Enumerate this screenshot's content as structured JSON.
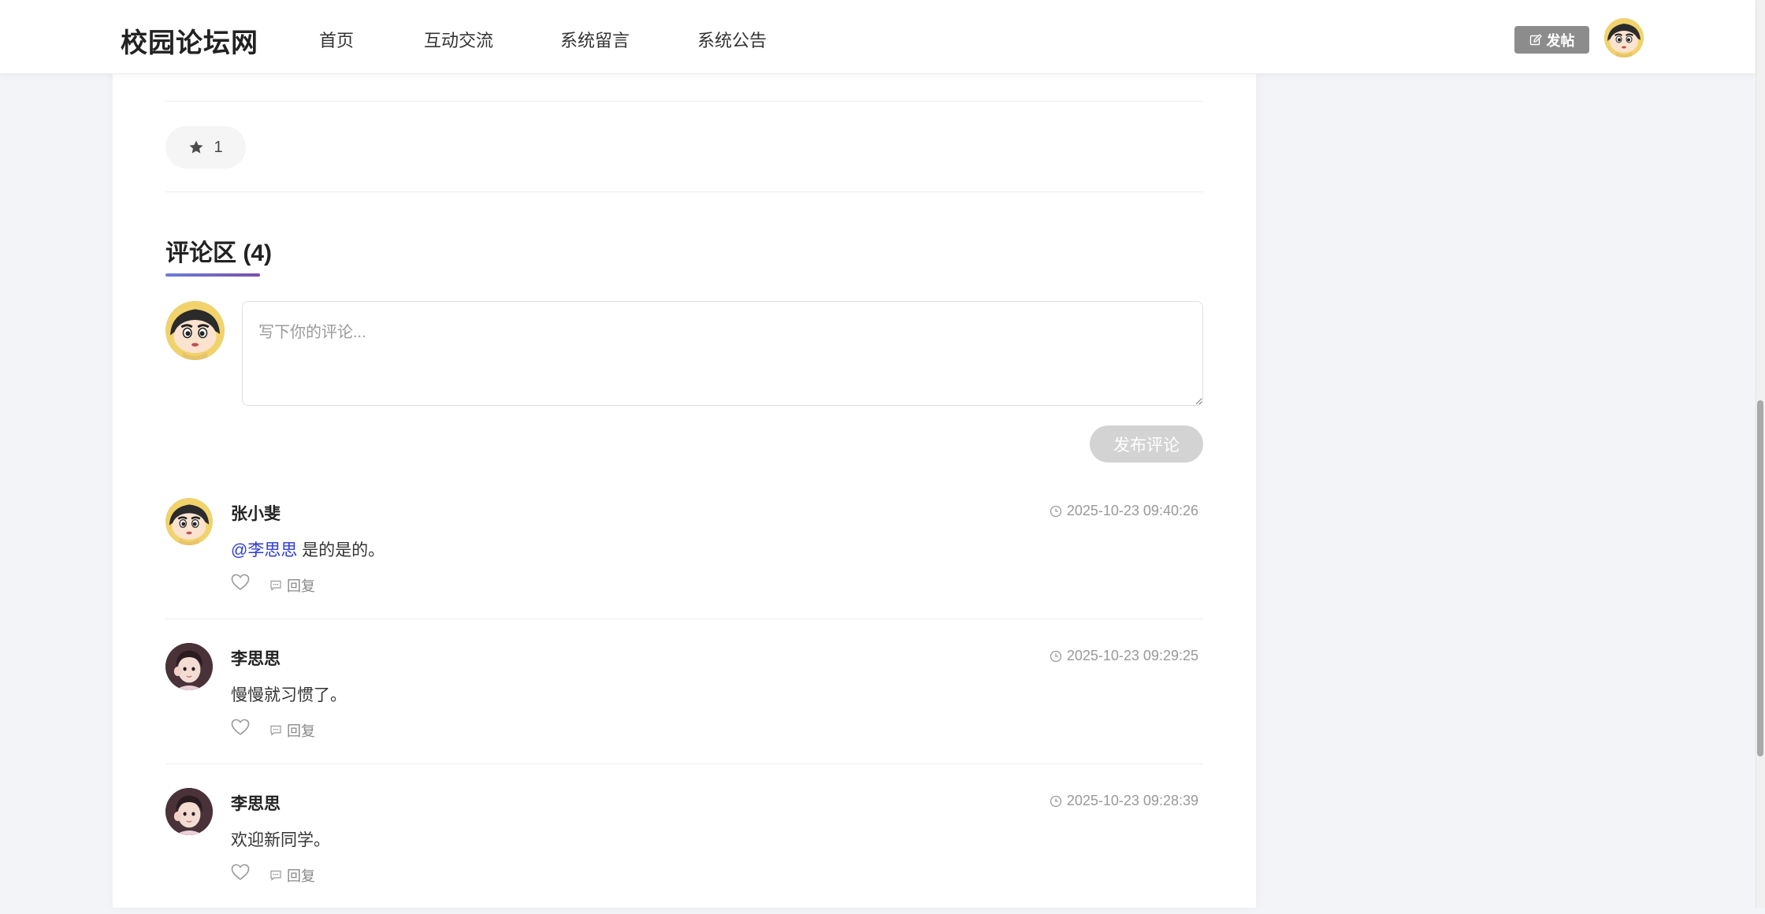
{
  "nav": {
    "brand": "校园论坛网",
    "links": [
      "首页",
      "互动交流",
      "系统留言",
      "系统公告"
    ],
    "post_button": "发帖"
  },
  "post": {
    "favorites": "1"
  },
  "comments_section": {
    "title": "评论区 (4)",
    "placeholder": "写下你的评论...",
    "submit_label": "发布评论",
    "reply_label": "回复",
    "items": [
      {
        "author": "张小斐",
        "time": "2025-10-23 09:40:26",
        "mention": "@李思思",
        "text": "是的是的。",
        "avatar": "cartoon-boy-avatar"
      },
      {
        "author": "李思思",
        "time": "2025-10-23 09:29:25",
        "mention": "",
        "text": "慢慢就习惯了。",
        "avatar": "girl-photo-avatar"
      },
      {
        "author": "李思思",
        "time": "2025-10-23 09:28:39",
        "mention": "",
        "text": "欢迎新同学。",
        "avatar": "girl-photo-avatar"
      }
    ]
  },
  "colors": {
    "accent_gradient_start": "#6a7fd8",
    "accent_gradient_end": "#7b4fa8",
    "mention": "#2b3bd6",
    "post_button_bg": "#8c8c8c",
    "submit_disabled_bg": "#d3d3d3"
  }
}
